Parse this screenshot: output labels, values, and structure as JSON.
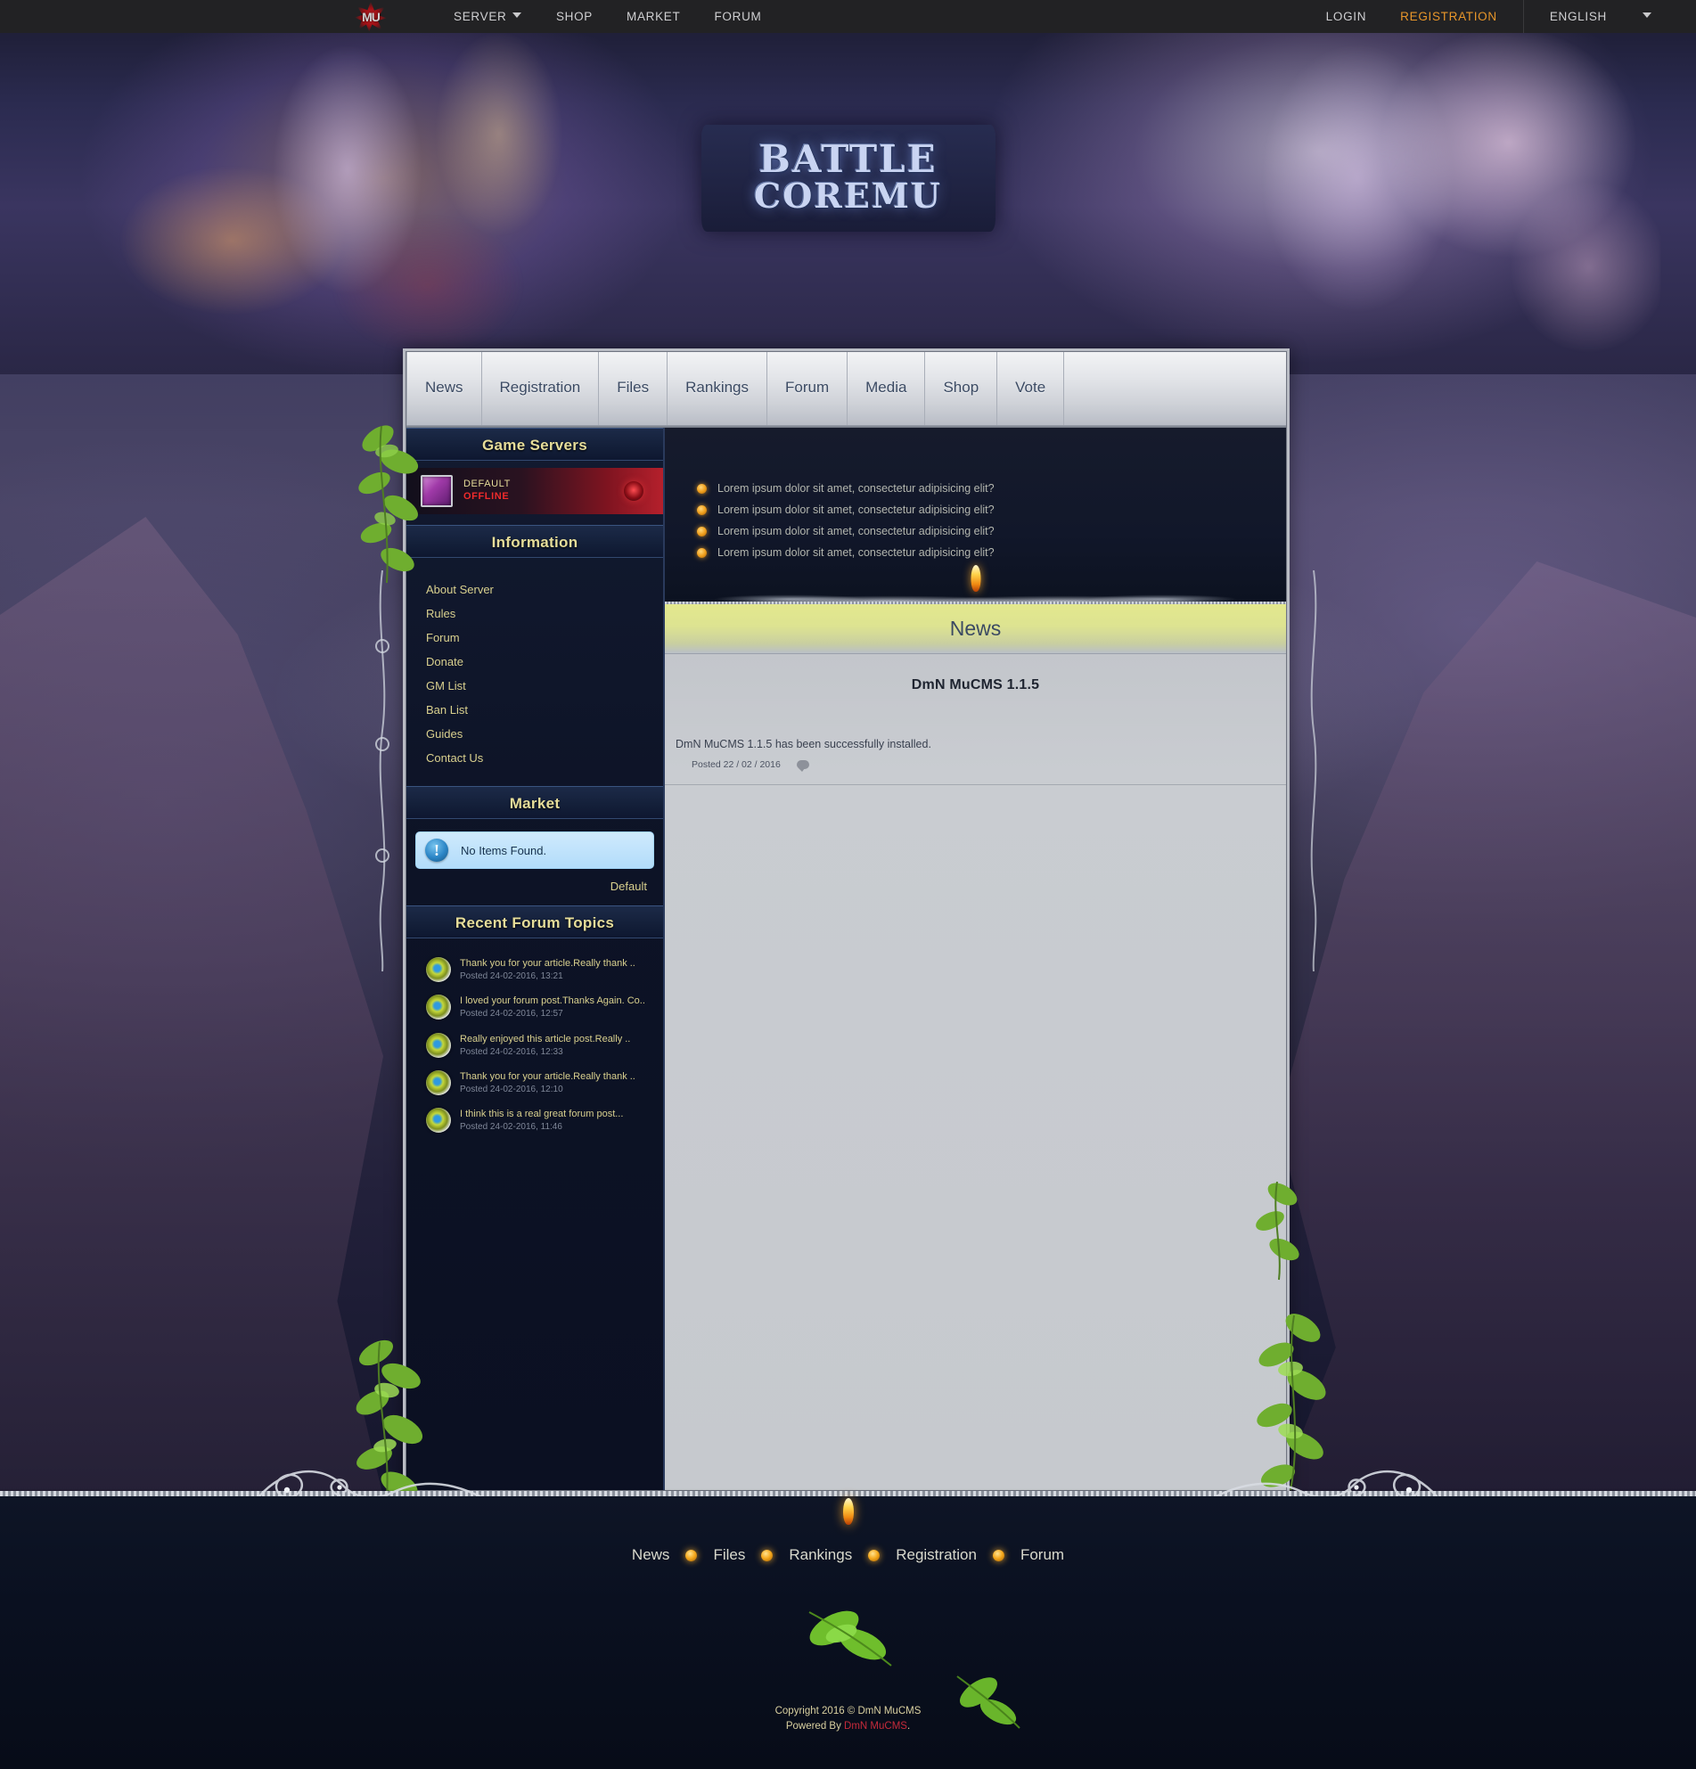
{
  "topbar": {
    "brand": "MU",
    "brand_icon": "mu-star-logo",
    "left_items": [
      {
        "label": "SERVER",
        "has_caret": true
      },
      {
        "label": "SHOP",
        "has_caret": false
      },
      {
        "label": "MARKET",
        "has_caret": false
      },
      {
        "label": "FORUM",
        "has_caret": false
      }
    ],
    "login_label": "LOGIN",
    "registration_label": "REGISTRATION",
    "language_label": "ENGLISH",
    "accent_color": "#e8962a"
  },
  "hero": {
    "logo_line1": "BATTLE",
    "logo_line2": "COREMU"
  },
  "tabs": [
    {
      "label": "News"
    },
    {
      "label": "Registration"
    },
    {
      "label": "Files"
    },
    {
      "label": "Rankings"
    },
    {
      "label": "Forum"
    },
    {
      "label": "Media"
    },
    {
      "label": "Shop"
    },
    {
      "label": "Vote"
    }
  ],
  "sidebar": {
    "game_servers": {
      "title": "Game Servers",
      "servers": [
        {
          "name": "DEFAULT",
          "status": "OFFLINE",
          "status_color": "#ef2b2b"
        }
      ]
    },
    "information": {
      "title": "Information",
      "links": [
        "About Server",
        "Rules",
        "Forum",
        "Donate",
        "GM List",
        "Ban List",
        "Guides",
        "Contact Us"
      ]
    },
    "market": {
      "title": "Market",
      "empty_message": "No Items Found.",
      "server_label": "Default"
    },
    "forum_topics": {
      "title": "Recent Forum Topics",
      "items": [
        {
          "title": "Thank you for your article.Really thank ..",
          "date": "Posted 24-02-2016, 13:21"
        },
        {
          "title": "I loved your forum post.Thanks Again. Co..",
          "date": "Posted 24-02-2016, 12:57"
        },
        {
          "title": "Really enjoyed this article post.Really ..",
          "date": "Posted 24-02-2016, 12:33"
        },
        {
          "title": "Thank you for your article.Really thank ..",
          "date": "Posted 24-02-2016, 12:10"
        },
        {
          "title": "I think this is a real great forum post...",
          "date": "Posted 24-02-2016, 11:46"
        }
      ]
    }
  },
  "ticker": {
    "items": [
      "Lorem ipsum dolor sit amet, consectetur adipisicing elit?",
      "Lorem ipsum dolor sit amet, consectetur adipisicing elit?",
      "Lorem ipsum dolor sit amet, consectetur adipisicing elit?",
      "Lorem ipsum dolor sit amet, consectetur adipisicing elit?"
    ]
  },
  "news": {
    "section_title": "News",
    "articles": [
      {
        "title": "DmN MuCMS 1.1.5",
        "body": "DmN MuCMS 1.1.5 has been successfully installed.",
        "posted": "Posted 22 / 02 / 2016"
      }
    ]
  },
  "footer": {
    "links": [
      "News",
      "Files",
      "Rankings",
      "Registration",
      "Forum"
    ],
    "copyright": "Copyright 2016 © DmN MuCMS",
    "powered_prefix": "Powered By ",
    "powered_brand": "DmN MuCMS",
    "powered_suffix": ".",
    "brand_color": "#c52a3a"
  }
}
